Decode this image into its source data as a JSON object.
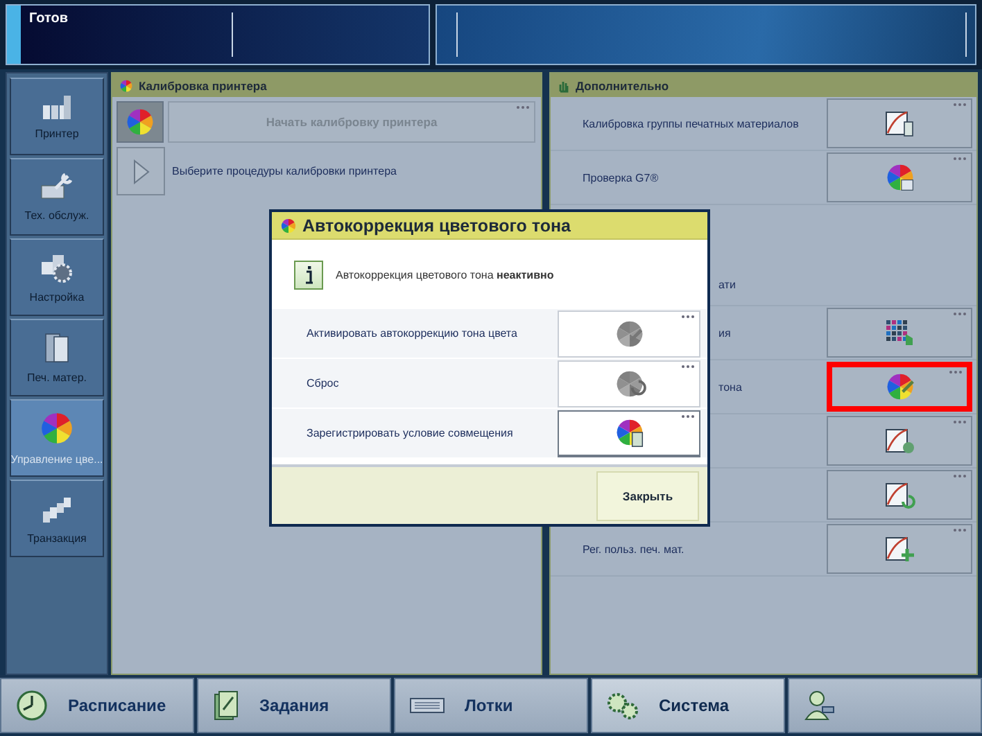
{
  "status_bar": {
    "status": "Готов"
  },
  "sidebar": {
    "items": [
      {
        "label": "Принтер",
        "selected": false
      },
      {
        "label": "Тех. обслуж.",
        "selected": false
      },
      {
        "label": "Настройка",
        "selected": false
      },
      {
        "label": "Печ. матер.",
        "selected": false
      },
      {
        "label": "Управление цве...",
        "selected": true
      },
      {
        "label": "Транзакция",
        "selected": false
      }
    ]
  },
  "calibration_panel": {
    "title": "Калибровка принтера",
    "start_button": {
      "label": "Начать калибровку принтера",
      "disabled": true
    },
    "procedures_text": "Выберите процедуры калибровки принтера"
  },
  "additional_panel": {
    "title": "Дополнительно",
    "rows": [
      {
        "kind": "action",
        "label": "Калибровка группы печатных материалов",
        "covered": false,
        "highlighted": false
      },
      {
        "kind": "action",
        "label": "Проверка G7®",
        "covered": false,
        "highlighted": false
      },
      {
        "kind": "note",
        "label": "ати",
        "covered": true
      },
      {
        "kind": "action",
        "label": "ия",
        "covered": true,
        "highlighted": false
      },
      {
        "kind": "action",
        "label": "тона",
        "covered": true,
        "highlighted": true
      },
      {
        "kind": "action",
        "highlighted": false
      },
      {
        "kind": "action",
        "highlighted": false
      },
      {
        "kind": "action",
        "label": "Рег. польз. печ. мат.",
        "covered": false,
        "highlighted": false
      }
    ]
  },
  "dialog": {
    "title": "Автокоррекция цветового тона",
    "info": "Автокоррекция цветового тона **неактивно**",
    "actions": [
      {
        "label": "Активировать автокоррекцию тона цвета",
        "disabled": true
      },
      {
        "label": "Сброс",
        "disabled": true
      },
      {
        "label": "Зарегистрировать условие совмещения",
        "disabled": false
      }
    ],
    "close_button": "Закрыть"
  },
  "bottom_tabs": [
    {
      "label": "Расписание",
      "selected": false
    },
    {
      "label": "Задания",
      "selected": false
    },
    {
      "label": "Лотки",
      "selected": false
    },
    {
      "label": "Система",
      "selected": true
    }
  ]
}
